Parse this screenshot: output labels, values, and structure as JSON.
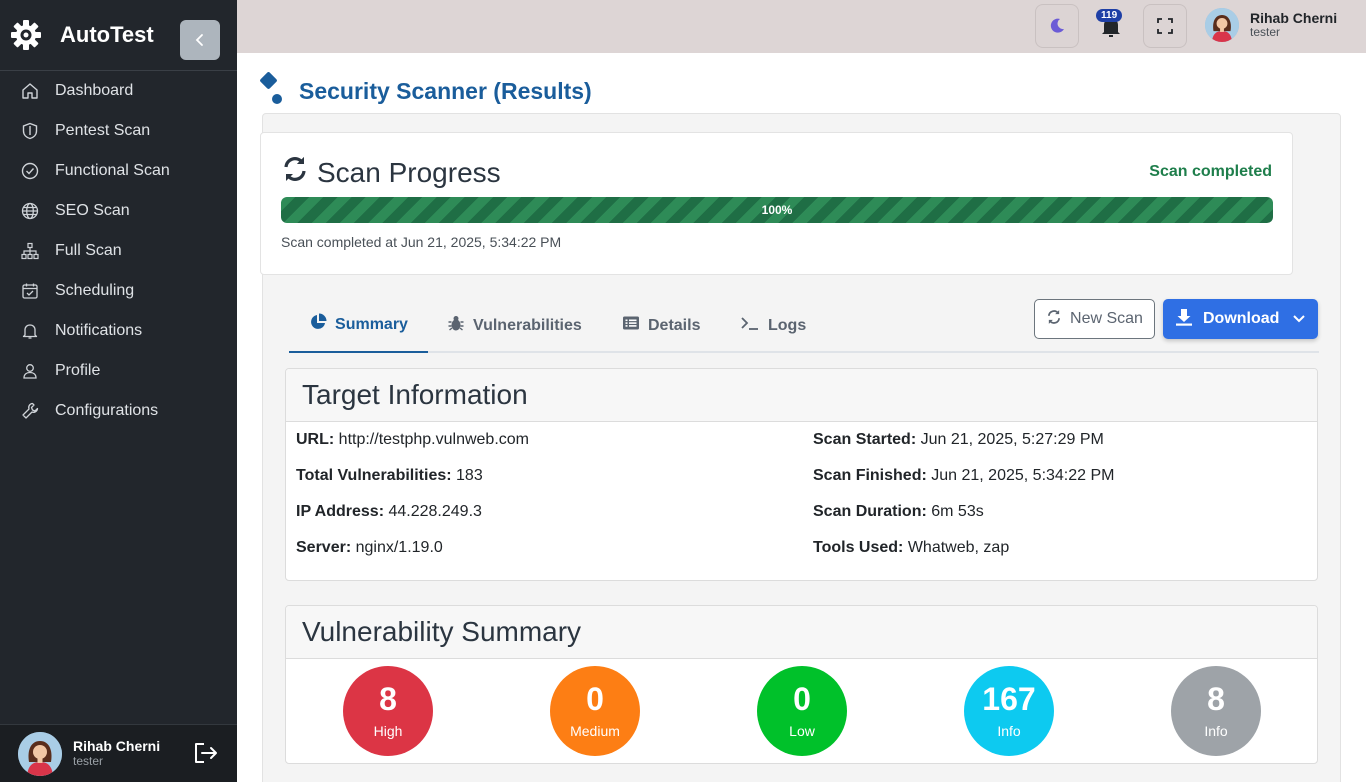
{
  "app": {
    "name": "AutoTest"
  },
  "sidebar": {
    "items": [
      {
        "label": "Dashboard",
        "icon": "home-icon"
      },
      {
        "label": "Pentest Scan",
        "icon": "shield-icon"
      },
      {
        "label": "Functional Scan",
        "icon": "check-circle-icon"
      },
      {
        "label": "SEO Scan",
        "icon": "globe-icon"
      },
      {
        "label": "Full Scan",
        "icon": "sitemap-icon"
      },
      {
        "label": "Scheduling",
        "icon": "calendar-check-icon"
      },
      {
        "label": "Notifications",
        "icon": "bell-icon"
      },
      {
        "label": "Profile",
        "icon": "user-icon"
      },
      {
        "label": "Configurations",
        "icon": "wrench-icon"
      }
    ],
    "user": {
      "name": "Rihab Cherni",
      "role": "tester"
    }
  },
  "topbar": {
    "notification_count": "119",
    "user": {
      "name": "Rihab Cherni",
      "role": "tester"
    }
  },
  "page": {
    "title": "Security Scanner (Results)"
  },
  "progress": {
    "title": "Scan Progress",
    "status": "Scan completed",
    "percent_label": "100%",
    "percent": 100,
    "completed_text": "Scan completed at Jun 21, 2025, 5:34:22 PM"
  },
  "tabs": [
    {
      "label": "Summary",
      "icon": "chart-pie-icon"
    },
    {
      "label": "Vulnerabilities",
      "icon": "bug-icon"
    },
    {
      "label": "Details",
      "icon": "list-alt-icon"
    },
    {
      "label": "Logs",
      "icon": "terminal-icon"
    }
  ],
  "actions": {
    "new_scan": "New Scan",
    "download": "Download"
  },
  "target_info": {
    "title": "Target Information",
    "fields": [
      {
        "label": "URL:",
        "value": "http://testphp.vulnweb.com"
      },
      {
        "label": "Total Vulnerabilities:",
        "value": "183"
      },
      {
        "label": "IP Address:",
        "value": "44.228.249.3"
      },
      {
        "label": "Server:",
        "value": "nginx/1.19.0"
      },
      {
        "label": "Scan Started:",
        "value": "Jun 21, 2025, 5:27:29 PM"
      },
      {
        "label": "Scan Finished:",
        "value": "Jun 21, 2025, 5:34:22 PM"
      },
      {
        "label": "Scan Duration:",
        "value": "6m 53s"
      },
      {
        "label": "Tools Used:",
        "value": "Whatweb, zap"
      }
    ]
  },
  "vuln_summary": {
    "title": "Vulnerability Summary",
    "counts": [
      {
        "count": "8",
        "label": "High",
        "color": "#dc3545"
      },
      {
        "count": "0",
        "label": "Medium",
        "color": "#fd7e14"
      },
      {
        "count": "0",
        "label": "Low",
        "color": "#00c12a"
      },
      {
        "count": "167",
        "label": "Info",
        "color": "#0dcaf0"
      },
      {
        "count": "8",
        "label": "Info",
        "color": "#9ea3a8"
      }
    ]
  }
}
